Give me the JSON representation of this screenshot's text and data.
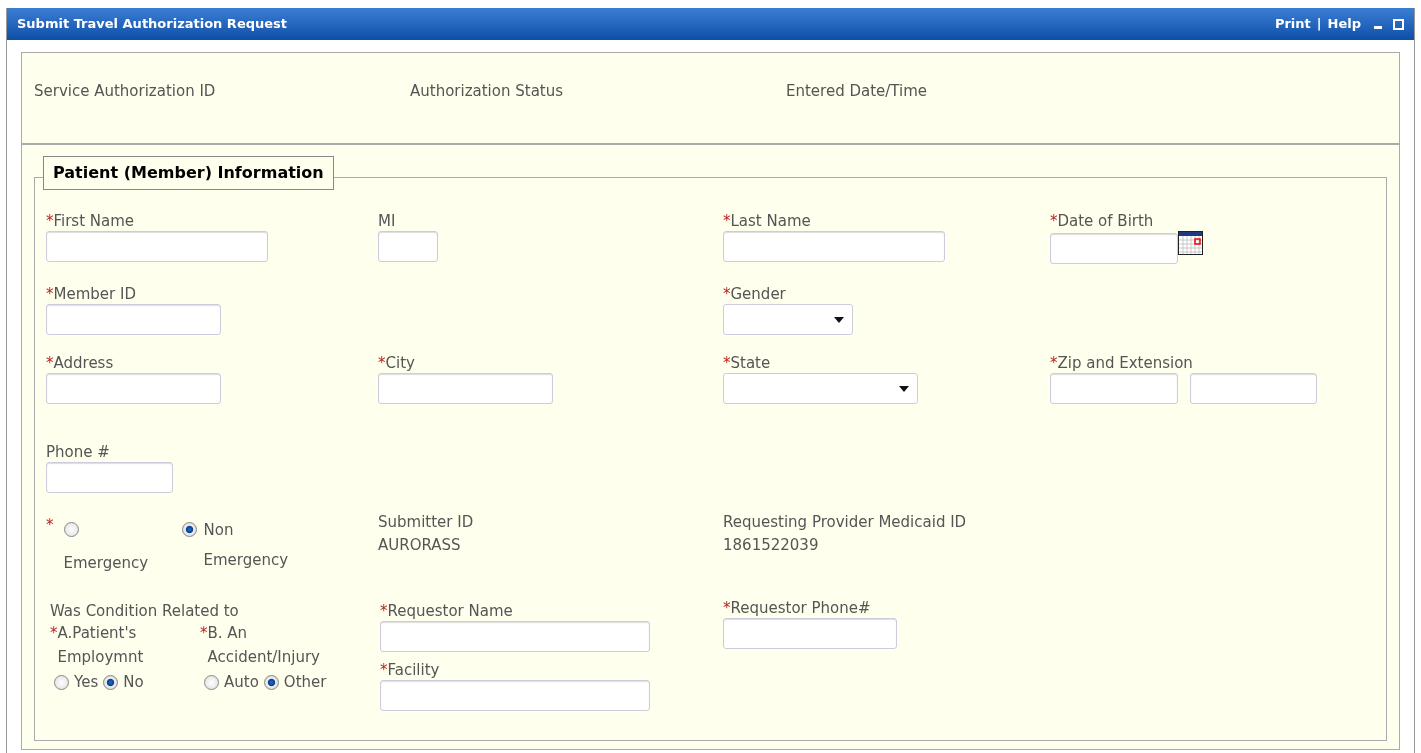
{
  "window": {
    "title": "Submit Travel Authorization Request",
    "links": [
      "Print",
      "Help"
    ],
    "separator": "|"
  },
  "required_mark": "*",
  "summary": [
    "Service Authorization ID",
    "Authorization Status",
    "Entered Date/Time"
  ],
  "section": {
    "title": "Patient (Member) Information",
    "fields": [
      {
        "label": "First Name",
        "required": true,
        "kind": "text"
      },
      {
        "label": "MI",
        "required": false,
        "kind": "text"
      },
      {
        "label": "Last Name",
        "required": true,
        "kind": "text"
      },
      {
        "label": "Date of Birth",
        "required": true,
        "kind": "date"
      },
      {
        "label": "Member ID",
        "required": true,
        "kind": "text"
      },
      {
        "label": "Gender",
        "required": true,
        "kind": "select"
      },
      {
        "label": "Address",
        "required": true,
        "kind": "text"
      },
      {
        "label": "City",
        "required": true,
        "kind": "text"
      },
      {
        "label": "State",
        "required": true,
        "kind": "select"
      },
      {
        "label": "Zip and Extension",
        "required": true,
        "kind": "zip"
      },
      {
        "label": "Phone #",
        "required": false,
        "kind": "text"
      }
    ],
    "emergency": {
      "required": true,
      "options": [
        {
          "label": "Emergency",
          "selected": false
        },
        {
          "label": "Non Emergency",
          "selected": true
        }
      ]
    },
    "info": [
      {
        "label": "Submitter ID",
        "value": "AURORASS"
      },
      {
        "label": "Requesting Provider Medicaid ID",
        "value": "1861522039"
      }
    ],
    "condition": {
      "title": "Was Condition Related to",
      "questions": [
        {
          "label": "A.Patient's Employmnt",
          "required": true,
          "options": [
            {
              "label": "Yes",
              "selected": false
            },
            {
              "label": "No",
              "selected": true
            }
          ]
        },
        {
          "label": "B. An Accident/Injury",
          "required": true,
          "options": [
            {
              "label": "Auto",
              "selected": false
            },
            {
              "label": "Other",
              "selected": true
            }
          ]
        }
      ]
    },
    "requestor": [
      {
        "label": "Requestor Name",
        "required": true
      },
      {
        "label": "Facility",
        "required": true
      },
      {
        "label": "Requestor Phone#",
        "required": true
      }
    ]
  }
}
